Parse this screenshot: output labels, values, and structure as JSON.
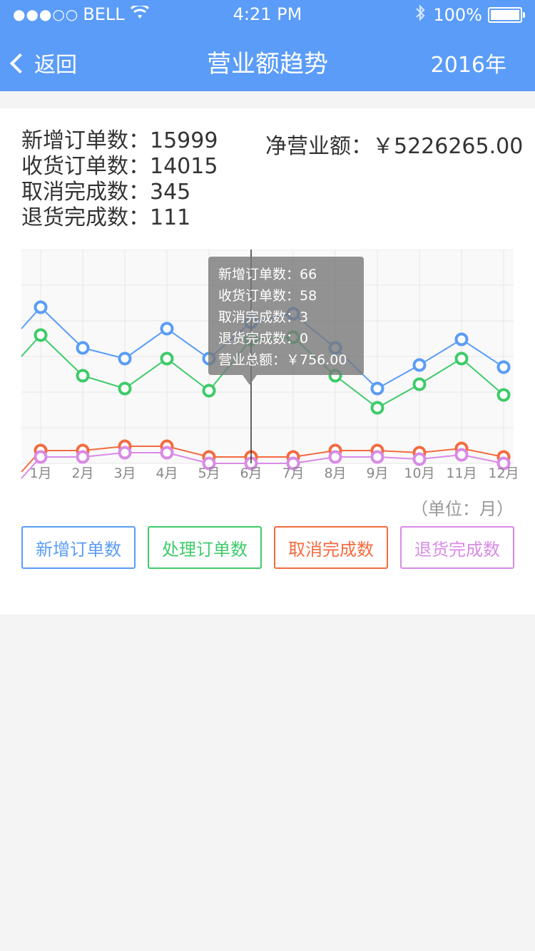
{
  "status_bar": {
    "carrier": "BELL",
    "signal": "●●●○○",
    "time": "4:21 PM",
    "battery": "100%",
    "icons": [
      "wifi-icon",
      "bluetooth-icon",
      "battery-icon"
    ]
  },
  "nav": {
    "back_label": "返回",
    "title": "营业额趋势",
    "year": "2016年"
  },
  "summary": {
    "new_orders": "新增订单数：15999",
    "received_orders": "收货订单数：14015",
    "cancelled": "取消完成数：345",
    "returned": "退货完成数：111",
    "net_revenue": "净营业额：￥5226265.00"
  },
  "chart_unit": "（单位：月）",
  "tooltip": {
    "lines": [
      "新增订单数：66",
      "收货订单数：58",
      "取消完成数：3",
      "退货完成数：0",
      "营业总额：￥756.00"
    ]
  },
  "legend": {
    "new_orders": "新增订单数",
    "processed_orders": "处理订单数",
    "cancelled": "取消完成数",
    "returned": "退货完成数"
  },
  "colors": {
    "header": "#5a9cf8",
    "blue": "#5a9cf8",
    "green": "#3ecb69",
    "orange": "#f36b3f",
    "pink": "#d98ae6"
  },
  "chart_data": {
    "type": "line",
    "categories": [
      "1月",
      "2月",
      "3月",
      "4月",
      "5月",
      "6月",
      "7月",
      "8月",
      "9月",
      "10月",
      "11月",
      "12月"
    ],
    "ylim": [
      0,
      100
    ],
    "grid": true,
    "series": [
      {
        "name": "新增订单数",
        "color": "#5a9cf8",
        "values": [
          73,
          54,
          49,
          63,
          49,
          66,
          70,
          54,
          35,
          46,
          58,
          45
        ]
      },
      {
        "name": "收货订单数",
        "color": "#3ecb69",
        "values": [
          60,
          41,
          35,
          49,
          34,
          58,
          59,
          41,
          26,
          37,
          49,
          32
        ]
      },
      {
        "name": "取消完成数",
        "color": "#f36b3f",
        "values": [
          6,
          6,
          8,
          8,
          3,
          3,
          3,
          6,
          6,
          5,
          7,
          3
        ]
      },
      {
        "name": "退货完成数",
        "color": "#d98ae6",
        "values": [
          3,
          3,
          5,
          5,
          0,
          0,
          0,
          3,
          3,
          2,
          4,
          0
        ]
      }
    ],
    "highlight_index": 5
  }
}
